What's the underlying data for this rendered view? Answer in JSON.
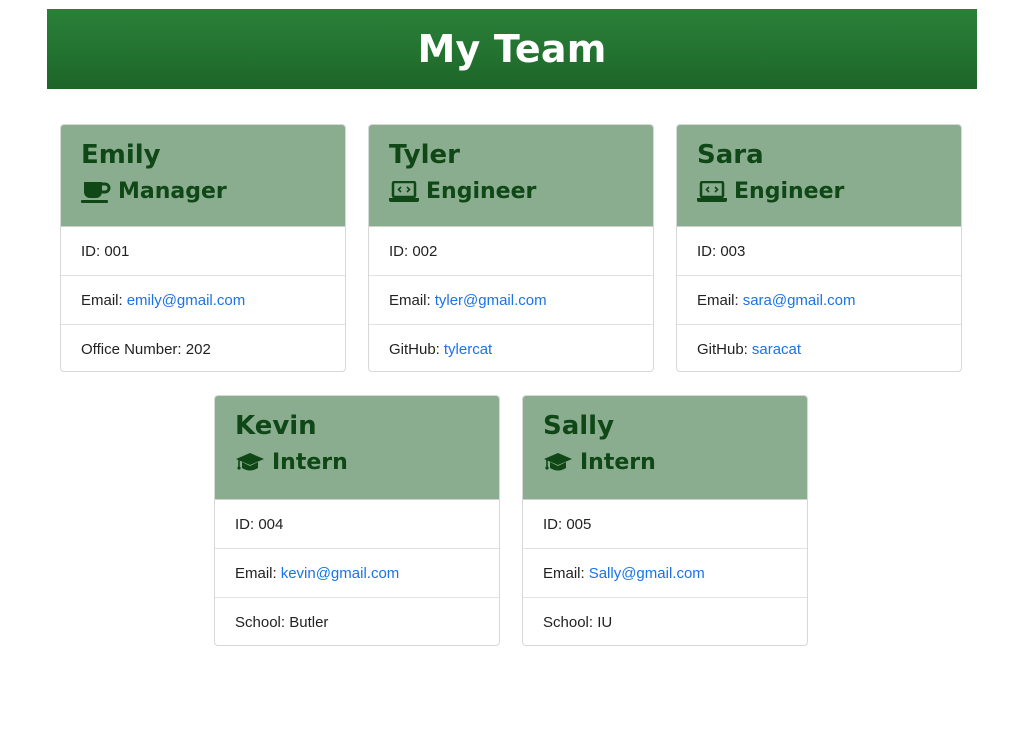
{
  "header": {
    "title": "My Team"
  },
  "colors": {
    "header_green": "#237330",
    "card_header_bg": "#89ad8e",
    "card_header_text": "#0f4716",
    "link": "#1a73e8"
  },
  "labels": {
    "id": "ID:",
    "email": "Email:",
    "office": "Office Number:",
    "github": "GitHub:",
    "school": "School:"
  },
  "cards": [
    {
      "name": "Emily",
      "role": "Manager",
      "icon": "coffee-cup-icon",
      "id": "001",
      "email": "emily@gmail.com",
      "extra": "202"
    },
    {
      "name": "Tyler",
      "role": "Engineer",
      "icon": "laptop-code-icon",
      "id": "002",
      "email": "tyler@gmail.com",
      "extra": "tylercat"
    },
    {
      "name": "Sara",
      "role": "Engineer",
      "icon": "laptop-code-icon",
      "id": "003",
      "email": "sara@gmail.com",
      "extra": "saracat"
    },
    {
      "name": "Kevin",
      "role": "Intern",
      "icon": "graduation-cap-icon",
      "id": "004",
      "email": "kevin@gmail.com",
      "extra": "Butler"
    },
    {
      "name": "Sally",
      "role": "Intern",
      "icon": "graduation-cap-icon",
      "id": "005",
      "email": "Sally@gmail.com",
      "extra": "IU"
    }
  ]
}
